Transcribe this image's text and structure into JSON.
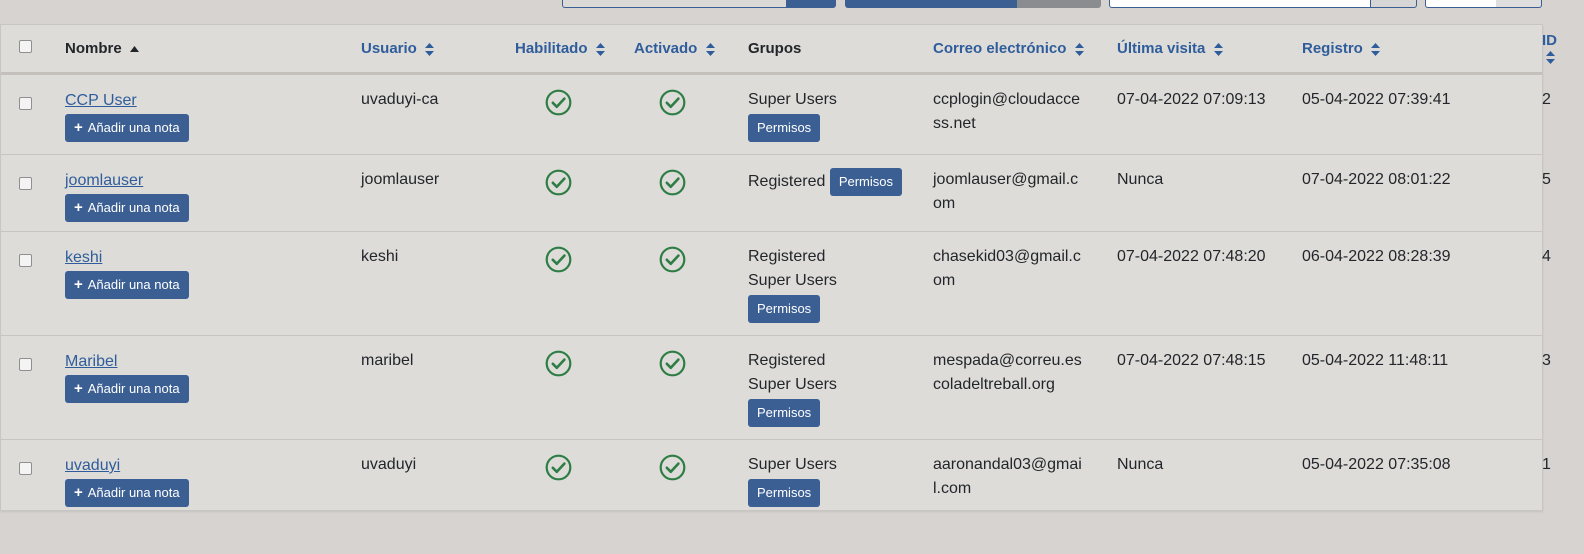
{
  "colors": {
    "accent": "#3b5f93",
    "link": "#2f5d9b",
    "check": "#2e7d45"
  },
  "columns": {
    "name": "Nombre",
    "username": "Usuario",
    "enabled": "Habilitado",
    "activated": "Activado",
    "groups": "Grupos",
    "email": "Correo electrónico",
    "last_visit": "Última visita",
    "registered": "Registro",
    "id": "ID"
  },
  "labels": {
    "add_note": "Añadir una nota",
    "permissions": "Permisos"
  },
  "users": [
    {
      "name": "CCP User",
      "username": "uvaduyi-ca",
      "groups": [
        "Super Users"
      ],
      "email": "ccplogin@cloudaccess.net",
      "last_visit": "07-04-2022 07:09:13",
      "registered": "05-04-2022 07:39:41",
      "id": "2"
    },
    {
      "name": "joomlauser",
      "username": "joomlauser",
      "groups": [
        "Registered"
      ],
      "email": "joomlauser@gmail.com",
      "last_visit": "Nunca",
      "registered": "07-04-2022 08:01:22",
      "id": "5"
    },
    {
      "name": "keshi",
      "username": "keshi",
      "groups": [
        "Registered",
        "Super Users"
      ],
      "email": "chasekid03@gmail.com",
      "last_visit": "07-04-2022 07:48:20",
      "registered": "06-04-2022 08:28:39",
      "id": "4"
    },
    {
      "name": "Maribel",
      "username": "maribel",
      "groups": [
        "Registered",
        "Super Users"
      ],
      "email": "mespada@correu.escoladeltreball.org",
      "last_visit": "07-04-2022 07:48:15",
      "registered": "05-04-2022 11:48:11",
      "id": "3"
    },
    {
      "name": "uvaduyi",
      "username": "uvaduyi",
      "groups": [
        "Super Users"
      ],
      "email": "aaronandal03@gmail.com",
      "last_visit": "Nunca",
      "registered": "05-04-2022 07:35:08",
      "id": "1"
    }
  ]
}
